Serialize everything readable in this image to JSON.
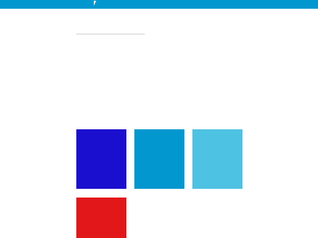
{
  "topbar": {
    "color": "#0297cf"
  },
  "input": {
    "value": "",
    "placeholder": ""
  },
  "tiles": [
    {
      "name": "blue",
      "color": "#1b0fcf"
    },
    {
      "name": "cyan",
      "color": "#0297cf"
    },
    {
      "name": "light-blue",
      "color": "#4ec2e3"
    },
    {
      "name": "red",
      "color": "#e2171a"
    }
  ]
}
